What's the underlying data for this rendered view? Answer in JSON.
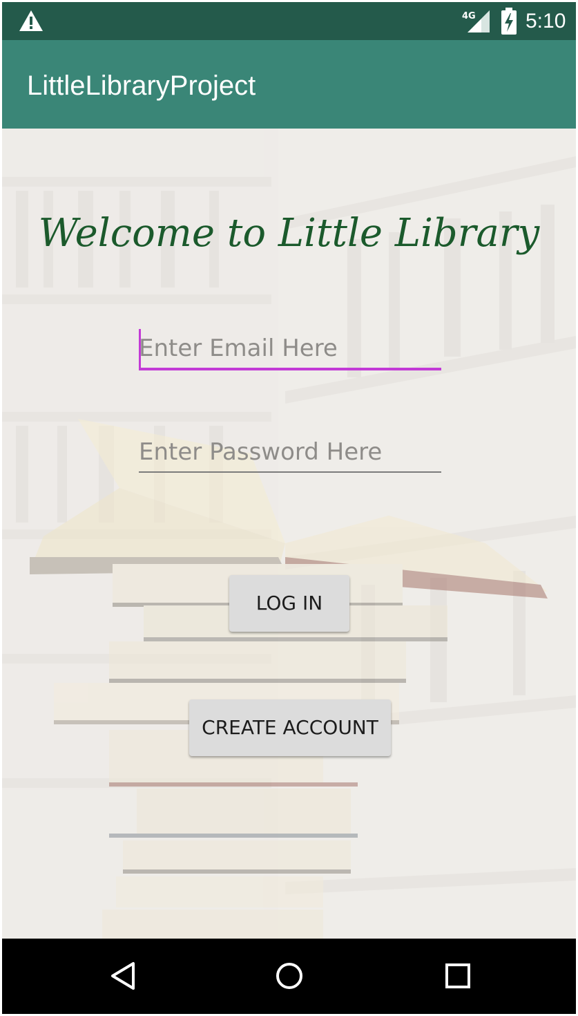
{
  "status_bar": {
    "network": "4G",
    "time": "5:10",
    "icons": [
      "warning-icon",
      "signal-icon",
      "battery-charging-icon"
    ]
  },
  "app_bar": {
    "title": "LittleLibraryProject"
  },
  "main": {
    "welcome": "Welcome to Little Library",
    "email": {
      "placeholder": "Enter Email Here",
      "value": ""
    },
    "password": {
      "placeholder": "Enter Password Here",
      "value": ""
    },
    "login_label": "LOG IN",
    "create_account_label": "CREATE ACCOUNT"
  },
  "nav_bar": {
    "icons": [
      "back-icon",
      "home-icon",
      "recent-apps-icon"
    ]
  },
  "colors": {
    "status_bar": "#245a4b",
    "app_bar": "#3a8677",
    "welcome_text": "#1b5a2c",
    "focus_accent": "#c23ad6",
    "button_bg": "#dcdcdc"
  }
}
